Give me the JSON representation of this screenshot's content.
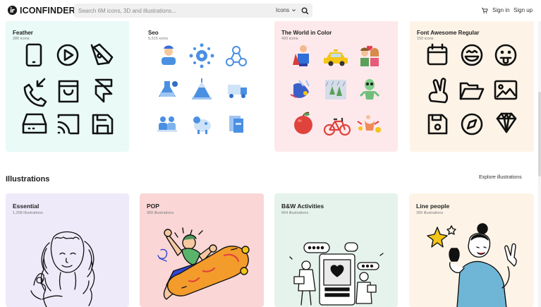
{
  "header": {
    "logo_text": "ICONFINDER",
    "search_placeholder": "Search 6M icons, 3D and illustrations...",
    "search_type": "Icons",
    "signin": "Sign in",
    "signup": "Sign up"
  },
  "icon_sets": [
    {
      "title": "Feather",
      "count": "286 icons",
      "bg": "#e9faf7"
    },
    {
      "title": "Seo",
      "count": "5,515 icons",
      "bg": "#ffffff"
    },
    {
      "title": "The World in Color",
      "count": "420 icons",
      "bg": "#fde9ec"
    },
    {
      "title": "Font Awesome Regular",
      "count": "150 icons",
      "bg": "#fdf4e7"
    }
  ],
  "illustrations": {
    "section_title": "Illustrations",
    "explore_link": "Explore illustrations",
    "cards": [
      {
        "title": "Essential",
        "count": "1,208 illustrations",
        "bg": "#eeeaf9"
      },
      {
        "title": "POP",
        "count": "300 illustrations",
        "bg": "#fad6d6"
      },
      {
        "title": "B&W Activities",
        "count": "664 illustrations",
        "bg": "#e5f3ec"
      },
      {
        "title": "Line people",
        "count": "399 illustrations",
        "bg": "#fdf4e7"
      }
    ]
  },
  "colors": {
    "blue_accent": "#4a90e2",
    "yellow_accent": "#f5c517",
    "pop_blue": "#2f47d6",
    "pop_orange": "#f39c2b",
    "line_blue": "#6fb6d6"
  }
}
